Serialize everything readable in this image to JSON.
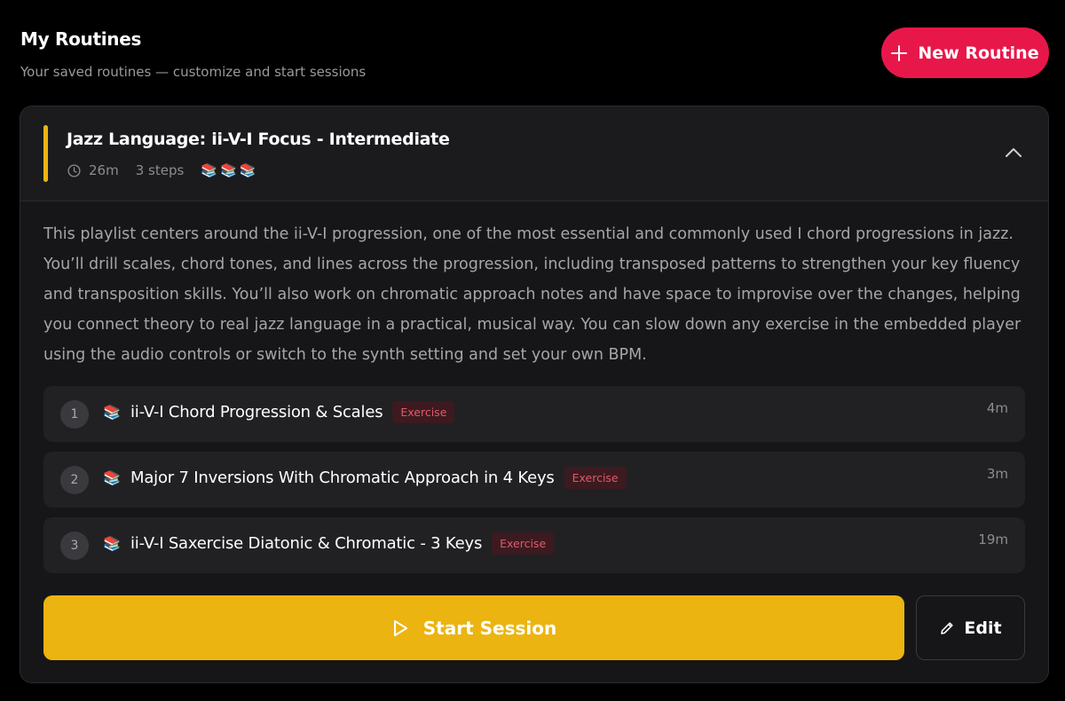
{
  "header": {
    "title": "My Routines",
    "subtitle": "Your saved routines — customize and start sessions",
    "new_routine_label": "New Routine"
  },
  "routine": {
    "title": "Jazz Language: ii-V-I Focus - Intermediate",
    "duration": "26m",
    "steps_count": "3 steps",
    "difficulty_icons": "📚📚📚",
    "accent_color": "#ebb410",
    "description": "This playlist centers around the ii-V-I progression, one of the most essential and commonly used I chord progressions in jazz. You’ll drill scales, chord tones, and lines across the progression, including transposed patterns to strengthen your key fluency and transposition skills. You’ll also work on chromatic approach notes and have space to improvise over the changes, helping you connect theory to real jazz language in a practical, musical way. You can slow down any exercise in the embedded player using the audio controls or switch to the synth setting and set your own BPM.",
    "steps": [
      {
        "number": "1",
        "icon": "📚",
        "title": "ii-V-I Chord Progression & Scales",
        "badge": "Exercise",
        "time": "4m"
      },
      {
        "number": "2",
        "icon": "📚",
        "title": "Major 7 Inversions With Chromatic Approach in 4 Keys",
        "badge": "Exercise",
        "time": "3m"
      },
      {
        "number": "3",
        "icon": "📚",
        "title": "ii-V-I Saxercise Diatonic & Chromatic - 3 Keys",
        "badge": "Exercise",
        "time": "19m"
      }
    ],
    "start_label": "Start Session",
    "edit_label": "Edit"
  },
  "colors": {
    "brand_red": "#e8174a",
    "brand_yellow": "#ebb410",
    "badge_text": "#e05a6c"
  }
}
